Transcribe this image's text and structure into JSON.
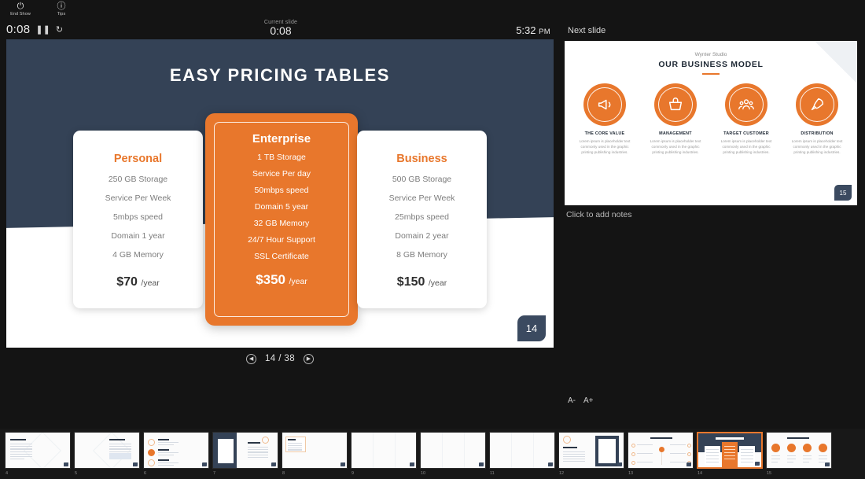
{
  "toolbar": {
    "end_show_label": "End Show",
    "end_show_icon": "power-icon",
    "tips_label": "Tips",
    "tips_icon": "info-icon"
  },
  "timer": {
    "elapsed": "0:08",
    "pause_icon": "pause-icon",
    "reset_icon": "reset-icon",
    "current_slide_label": "Current slide",
    "current_slide_time": "0:08",
    "clock": "5:32",
    "clock_ampm": "PM"
  },
  "next_slide_label": "Next slide",
  "slide": {
    "title": "EASY PRICING TABLES",
    "badge": "14",
    "background_color": "#344256",
    "accent_color": "#e8772c",
    "plans": [
      {
        "name": "Personal",
        "features": [
          "250 GB Storage",
          "Service Per Week",
          "5mbps speed",
          "Domain 1 year",
          "4 GB Memory"
        ],
        "price": "$70",
        "period": "/year",
        "featured": false
      },
      {
        "name": "Enterprise",
        "features": [
          "1 TB Storage",
          "Service Per day",
          "50mbps speed",
          "Domain 5 year",
          "32 GB Memory",
          "24/7 Hour Support",
          "SSL Certificate"
        ],
        "price": "$350",
        "period": "/year",
        "featured": true
      },
      {
        "name": "Business",
        "features": [
          "500 GB Storage",
          "Service Per Week",
          "25mbps speed",
          "Domain 2 year",
          "8 GB Memory"
        ],
        "price": "$150",
        "period": "/year",
        "featured": false
      }
    ]
  },
  "nav": {
    "prev_icon": "chevron-left-icon",
    "next_icon": "chevron-right-icon",
    "counter": "14 / 38",
    "current": 14,
    "total": 38
  },
  "preview": {
    "eyebrow": "Wynter Studio",
    "title": "OUR BUSINESS MODEL",
    "badge": "15",
    "columns": [
      {
        "icon": "megaphone-icon",
        "label": "THE CORE VALUE",
        "text": "Lorem ipsum is placeholder text commonly used in the graphic printing publishing industries."
      },
      {
        "icon": "basket-icon",
        "label": "MANAGEMENT",
        "text": "Lorem ipsum is placeholder text commonly used in the graphic printing publishing industries."
      },
      {
        "icon": "people-icon",
        "label": "TARGET CUSTOMER",
        "text": "Lorem ipsum is placeholder text commonly used in the graphic printing publishing industries."
      },
      {
        "icon": "rocket-icon",
        "label": "DISTRIBUTION",
        "text": "Lorem ipsum is placeholder text commonly used in the graphic printing publishing industries."
      }
    ]
  },
  "notes": {
    "placeholder": "Click to add notes",
    "decrease_font_label": "A-",
    "increase_font_label": "A+"
  },
  "filmstrip": {
    "thumbs": [
      {
        "number": "4",
        "kind": "text-left",
        "active": false
      },
      {
        "number": "5",
        "kind": "text-right",
        "active": false
      },
      {
        "number": "6",
        "kind": "list-icons",
        "active": false
      },
      {
        "number": "7",
        "kind": "navy-frame",
        "active": false
      },
      {
        "number": "8",
        "kind": "card-note",
        "active": false
      },
      {
        "number": "9",
        "kind": "blank",
        "active": false
      },
      {
        "number": "10",
        "kind": "blank",
        "active": false
      },
      {
        "number": "11",
        "kind": "blank",
        "active": false
      },
      {
        "number": "12",
        "kind": "navy-right",
        "active": false
      },
      {
        "number": "13",
        "kind": "timeline",
        "active": false
      },
      {
        "number": "14",
        "kind": "pricing",
        "active": true
      },
      {
        "number": "15",
        "kind": "four-circles",
        "active": false
      }
    ]
  }
}
